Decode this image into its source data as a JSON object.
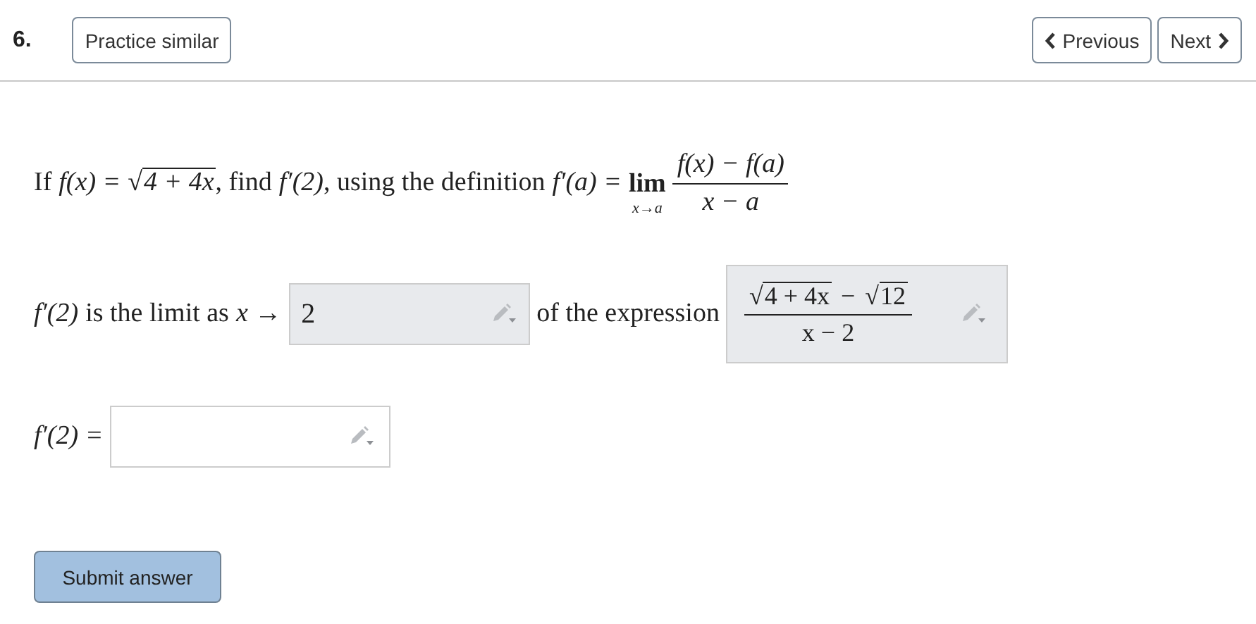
{
  "header": {
    "number": "6.",
    "practice_button": "Practice similar",
    "previous_button": "Previous",
    "next_button": "Next"
  },
  "statement": {
    "text_1": "If",
    "formula_1": {
      "lhs": "f(x) =",
      "radical": {
        "sign": "√",
        "radicand": "4 + 4x"
      }
    },
    "text_2": ", find",
    "formula_2": "f′(2)",
    "text_3": ", using the definition",
    "formula_3": "f′(a) =",
    "limit": {
      "operator": "lim",
      "subscript": "x→a"
    },
    "fraction": {
      "numerator": "f(x) − f(a)",
      "denominator": "x − a"
    }
  },
  "limit_row": {
    "formula": "f′(2)",
    "text_1": "is the limit as",
    "arrow_formula": "x →",
    "limit_field": {
      "value": "2"
    },
    "text_2": "of the expression",
    "expression_field": {
      "numerator": [
        {
          "kind": "radical",
          "sign": "√",
          "radicand": "4 + 4x"
        },
        {
          "kind": "operator",
          "text": "−"
        },
        {
          "kind": "radical",
          "sign": "√",
          "radicand": "12"
        }
      ],
      "denominator": "x − 2"
    }
  },
  "answer_row": {
    "formula": "f′(2) ="
  },
  "submit_button": "Submit answer"
}
